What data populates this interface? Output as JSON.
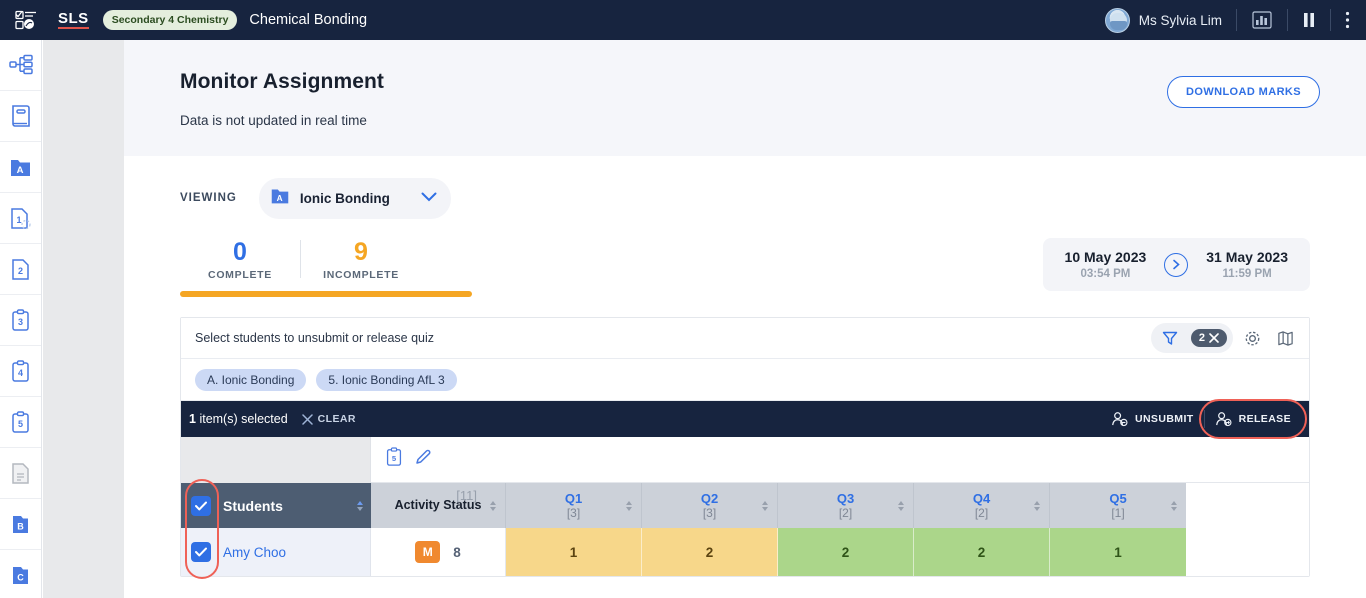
{
  "topbar": {
    "menu_icon": "assignment-menu-icon",
    "logo_text": "SLS",
    "course_chip": "Secondary 4 Chemistry",
    "lesson_title": "Chemical Bonding",
    "user_name": "Ms Sylvia Lim",
    "avatar_icon": "user-avatar",
    "stats_icon": "bar-chart-icon",
    "pause_icon": "pause-icon",
    "more_icon": "more-vertical-icon",
    "accent": "#17243f"
  },
  "rail": {
    "items": [
      {
        "icon": "sitemap-icon",
        "label": ""
      },
      {
        "icon": "book-icon",
        "label": ""
      },
      {
        "icon": "folder-a-icon",
        "label": "A"
      },
      {
        "icon": "page-1-icon",
        "label": "1"
      },
      {
        "icon": "page-2-icon",
        "label": "2"
      },
      {
        "icon": "clipboard-3-icon",
        "label": "3"
      },
      {
        "icon": "clipboard-4-icon",
        "label": "4"
      },
      {
        "icon": "clipboard-5-icon",
        "label": "5"
      },
      {
        "icon": "document-icon",
        "label": ""
      },
      {
        "icon": "folder-b-icon",
        "label": "B"
      },
      {
        "icon": "folder-c-icon",
        "label": "C"
      }
    ]
  },
  "page": {
    "title": "Monitor Assignment",
    "subtitle": "Data is not updated in real time",
    "download_label": "DOWNLOAD MARKS"
  },
  "viewing": {
    "label": "VIEWING",
    "selected": "Ionic Bonding",
    "badge": "A",
    "chevron_icon": "chevron-down-icon"
  },
  "stats": {
    "complete_value": "0",
    "complete_label": "COMPLETE",
    "incomplete_value": "9",
    "incomplete_label": "INCOMPLETE",
    "complete_color": "#2f6fe4",
    "incomplete_color": "#f5a623",
    "progress_percent": 100
  },
  "daterange": {
    "start_date": "10 May 2023",
    "start_time": "03:54 PM",
    "end_date": "31 May 2023",
    "end_time": "11:59 PM",
    "arrow_icon": "chevron-right-circle-icon"
  },
  "panel": {
    "hint": "Select students to unsubmit or release quiz",
    "filter_icon": "funnel-icon",
    "filter_count": "2",
    "filter_clear_icon": "close-icon",
    "settings_icon": "gear-icon",
    "map_icon": "map-icon",
    "chips": [
      "A. Ionic Bonding",
      "5. Ionic Bonding AfL 3"
    ]
  },
  "selection": {
    "count": "1",
    "count_suffix": "item(s) selected",
    "clear_label": "CLEAR",
    "clear_icon": "close-icon",
    "unsubmit_label": "UNSUBMIT",
    "unsubmit_icon": "person-minus-icon",
    "release_label": "RELEASE",
    "release_icon": "person-plus-icon",
    "highlight_color": "#ef6157"
  },
  "table": {
    "toolbar_icons": [
      "clipboard-5-icon",
      "pen-icon"
    ],
    "students_header": "Students",
    "activity_header": "Activity Status",
    "activity_max": "[11]",
    "questions": [
      {
        "label": "Q1",
        "max": "[3]"
      },
      {
        "label": "Q2",
        "max": "[3]"
      },
      {
        "label": "Q3",
        "max": "[2]"
      },
      {
        "label": "Q4",
        "max": "[2]"
      },
      {
        "label": "Q5",
        "max": "[1]"
      }
    ],
    "rows": [
      {
        "name": "Amy Choo",
        "checked": true,
        "status_badge": "M",
        "status_score": "8",
        "scores": [
          {
            "value": "1",
            "tone": "amber"
          },
          {
            "value": "2",
            "tone": "amber"
          },
          {
            "value": "2",
            "tone": "green"
          },
          {
            "value": "2",
            "tone": "green"
          },
          {
            "value": "1",
            "tone": "green"
          }
        ]
      }
    ]
  }
}
